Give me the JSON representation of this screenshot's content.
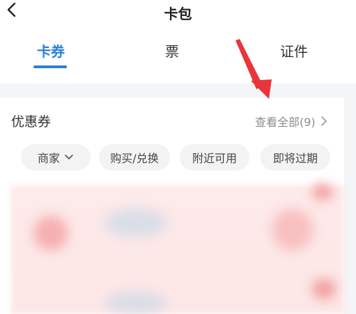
{
  "header": {
    "title": "卡包"
  },
  "tabs": [
    {
      "label": "卡券",
      "active": true
    },
    {
      "label": "票",
      "active": false
    },
    {
      "label": "证件",
      "active": false
    }
  ],
  "coupons": {
    "title": "优惠券",
    "view_all": "查看全部(9)"
  },
  "filters": [
    {
      "label": "商家",
      "dropdown": true
    },
    {
      "label": "购买/兑换"
    },
    {
      "label": "附近可用"
    },
    {
      "label": "即将过期"
    }
  ],
  "colors": {
    "accent": "#2d7fd8",
    "annotation_arrow": "#e8343b"
  },
  "icons": [
    "back-icon",
    "chevron-right-icon",
    "chevron-down-icon"
  ]
}
